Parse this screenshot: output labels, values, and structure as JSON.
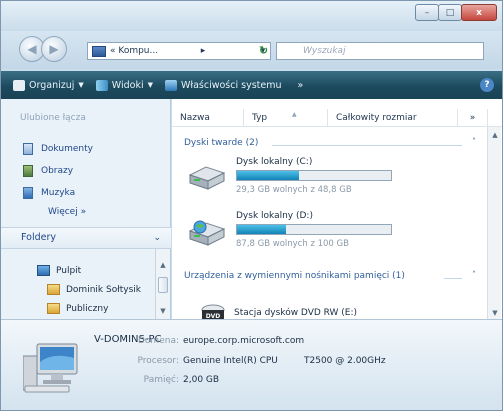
{
  "window": {
    "title_buttons": {
      "minimize": "–",
      "maximize": "□",
      "close": "x"
    }
  },
  "address_bar": {
    "breadcrumb": "« Kompu...",
    "breadcrumb_arrow": "▸",
    "dropdown": "▾",
    "refresh": "↻",
    "search_placeholder": "Wyszukaj"
  },
  "toolbar": {
    "items": [
      {
        "label": "Organizuj",
        "icon": "organize-icon"
      },
      {
        "label": "Widoki",
        "icon": "views-icon"
      },
      {
        "label": "Właściwości systemu",
        "icon": "system-properties-icon"
      }
    ],
    "more": "»",
    "help": "?"
  },
  "navigation": {
    "favorites_header": "Ulubione łącza",
    "favorites": [
      {
        "label": "Dokumenty",
        "icon": "documents-icon"
      },
      {
        "label": "Obrazy",
        "icon": "pictures-icon"
      },
      {
        "label": "Muzyka",
        "icon": "music-icon"
      }
    ],
    "more": "Więcej  »",
    "folders_header": "Foldery",
    "tree": [
      {
        "label": "Pulpit",
        "icon": "desktop-icon"
      },
      {
        "label": "Dominik Sołtysik",
        "icon": "user-folder-icon"
      },
      {
        "label": "Publiczny",
        "icon": "public-folder-icon"
      }
    ]
  },
  "columns": {
    "name": "Nazwa",
    "type": "Typ",
    "total_size": "Całkowity rozmiar",
    "more": "»"
  },
  "groups": {
    "hard_disks": "Dyski twarde (2)",
    "removable": "Urządzenia z wymiennymi nośnikami pamięci (1)"
  },
  "drives": [
    {
      "name": "Dysk lokalny (C:)",
      "free_text": "29,3 GB wolnych z 48,8 GB",
      "used_fraction": 0.4
    },
    {
      "name": "Dysk lokalny (D:)",
      "free_text": "87,8 GB wolnych z 100 GB",
      "used_fraction": 0.32
    }
  ],
  "removable_devices": [
    {
      "name": "Stacja dysków DVD RW (E:)",
      "icon": "dvd-drive-icon"
    }
  ],
  "details": {
    "pc_name": "V-DOMINS-PC",
    "domain_label": "Domena:",
    "domain_value": "europe.corp.microsoft.com",
    "cpu_label": "Procesor:",
    "cpu_value": "Genuine Intel(R) CPU",
    "cpu_value2": "T2500  @ 2.00GHz",
    "memory_label": "Pamięć:",
    "memory_value": "2,00 GB"
  }
}
